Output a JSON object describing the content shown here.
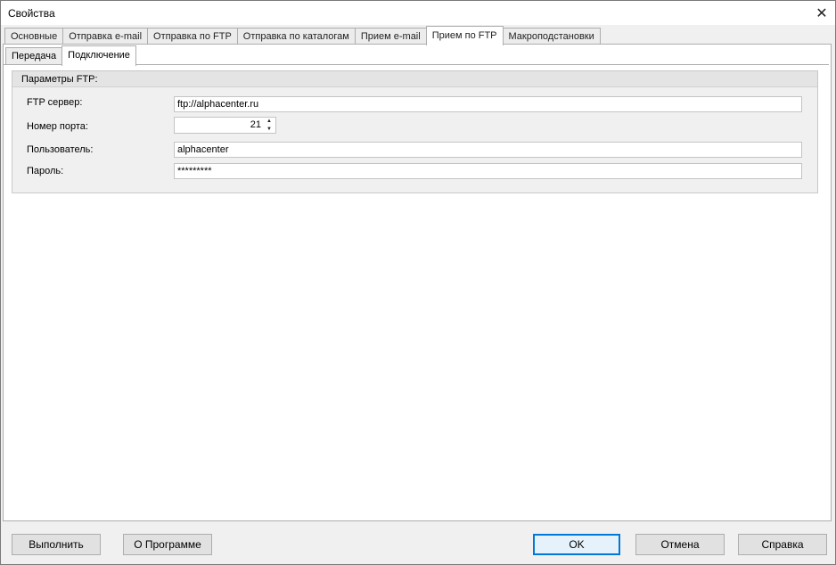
{
  "window": {
    "title": "Свойства"
  },
  "tabs": [
    {
      "label": "Основные"
    },
    {
      "label": "Отправка e-mail"
    },
    {
      "label": "Отправка по FTP"
    },
    {
      "label": "Отправка по каталогам"
    },
    {
      "label": "Прием e-mail"
    },
    {
      "label": "Прием по FTP",
      "active": true
    },
    {
      "label": "Макроподстановки"
    }
  ],
  "subtabs": [
    {
      "label": "Передача"
    },
    {
      "label": "Подключение",
      "active": true
    }
  ],
  "group": {
    "title": "Параметры FTP:",
    "ftp_server_label": "FTP сервер:",
    "ftp_server_value": "ftp://alphacenter.ru",
    "port_label": "Номер порта:",
    "port_value": "21",
    "user_label": "Пользователь:",
    "user_value": "alphacenter",
    "password_label": "Пароль:",
    "password_value": "*********"
  },
  "buttons": {
    "run": "Выполнить",
    "about": "О Программе",
    "ok": "OK",
    "cancel": "Отмена",
    "help": "Справка"
  }
}
